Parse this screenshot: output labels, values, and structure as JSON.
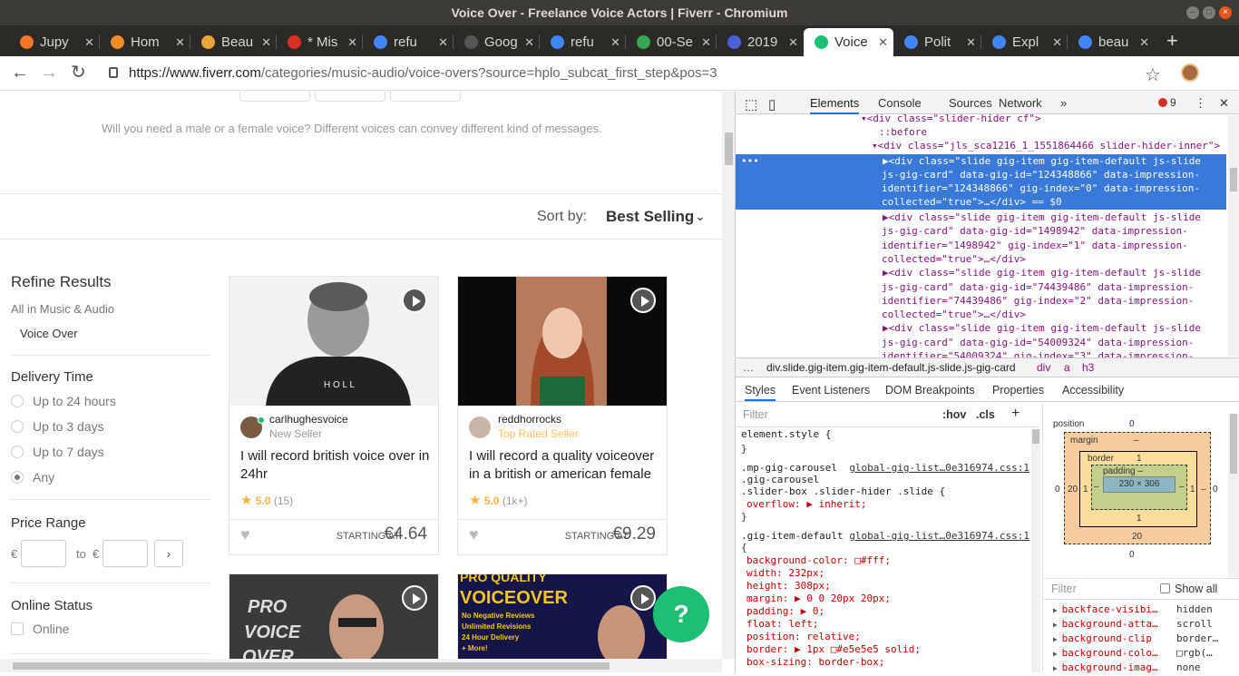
{
  "window": {
    "title": "Voice Over - Freelance Voice Actors | Fiverr - Chromium"
  },
  "tabs": [
    {
      "label": "Jupy",
      "icon": "jupyter-icon",
      "color": "#f37726"
    },
    {
      "label": "Hom",
      "icon": "home-icon",
      "color": "#f28b25"
    },
    {
      "label": "Beau",
      "icon": "book-icon",
      "color": "#e8a33d"
    },
    {
      "label": "* Mis",
      "icon": "notes-icon",
      "color": "#d93025"
    },
    {
      "label": "refu",
      "icon": "google-icon",
      "color": "#4285f4"
    },
    {
      "label": "Goog",
      "icon": "wikipedia-icon",
      "color": "#555555"
    },
    {
      "label": "refu",
      "icon": "google-icon",
      "color": "#4285f4"
    },
    {
      "label": "00-Se",
      "icon": "drive-icon",
      "color": "#34a853"
    },
    {
      "label": "2019",
      "icon": "docs-icon",
      "color": "#4a62d8"
    },
    {
      "label": "Voice",
      "icon": "fiverr-icon",
      "color": "#1dbf73",
      "active": true
    },
    {
      "label": "Polit",
      "icon": "google-icon",
      "color": "#4285f4"
    },
    {
      "label": "Expl",
      "icon": "google-icon",
      "color": "#4285f4"
    },
    {
      "label": "beau",
      "icon": "google-icon",
      "color": "#4285f4"
    }
  ],
  "addressbar": {
    "host": "https://www.fiverr.com",
    "path": "/categories/music-audio/voice-overs?source=hplo_subcat_first_step&pos=3"
  },
  "page": {
    "voice_hint": "Will you need a male or a female voice? Different voices can convey different kind of messages.",
    "sort_label": "Sort by:",
    "sort_value": "Best Selling",
    "sidebar": {
      "refine_title": "Refine Results",
      "all_in": "All in Music & Audio",
      "subcategory": "Voice Over",
      "delivery_title": "Delivery Time",
      "delivery_options": [
        "Up to 24 hours",
        "Up to 3 days",
        "Up to 7 days",
        "Any"
      ],
      "delivery_selected": "Any",
      "price_title": "Price Range",
      "currency": "€",
      "to_label": "to",
      "go_label": "›",
      "online_title": "Online Status",
      "online_label": "Online"
    },
    "gigs": [
      {
        "seller": "carlhughesvoice",
        "level": "New Seller",
        "level_color": "#999999",
        "title": "I will record british voice over in 24hr",
        "rating": "5.0",
        "reviews": "(15)",
        "starting": "STARTING AT",
        "price": "€4.64"
      },
      {
        "seller": "reddhorrocks",
        "level": "Top Rated Seller",
        "level_color": "#ffbe5b",
        "title": "I will record a quality voiceover in a british or american female",
        "rating": "5.0",
        "reviews": "(1k+)",
        "starting": "STARTING AT",
        "price": "€9.29"
      }
    ],
    "banner_gig": {
      "line1": "PRO",
      "line2": "VOICE",
      "line3": "OVER",
      "headline1": "PRO QUALITY",
      "headline2": "VOICEOVER",
      "bullets": [
        "No Negative Reviews",
        "Unlimited Revisions",
        "24 Hour Delivery",
        "+ More!"
      ]
    },
    "help_label": "?"
  },
  "devtools": {
    "tabs": [
      "Elements",
      "Console",
      "Sources",
      "Network"
    ],
    "more": "»",
    "errors": "9",
    "dom_lines": [
      "<div class=\"slider-hider cf\">",
      "::before",
      "<div class=\"jls_sca1216_1_1551864466 slider-hider-inner\">"
    ],
    "selected_lines": [
      "▶<div class=\"slide gig-item gig-item-default js-slide",
      "js-gig-card\" data-gig-id=\"124348866\" data-impression-",
      "identifier=\"124348866\" gig-index=\"0\" data-impression-",
      "collected=\"true\">…</div> == $0"
    ],
    "other_lines": [
      "▶<div class=\"slide gig-item gig-item-default js-slide",
      "js-gig-card\" data-gig-id=\"1498942\" data-impression-",
      "identifier=\"1498942\" gig-index=\"1\" data-impression-",
      "collected=\"true\">…</div>",
      "▶<div class=\"slide gig-item gig-item-default js-slide",
      "js-gig-card\" data-gig-id=\"74439486\" data-impression-",
      "identifier=\"74439486\" gig-index=\"2\" data-impression-",
      "collected=\"true\">…</div>",
      "▶<div class=\"slide gig-item gig-item-default js-slide",
      "js-gig-card\" data-gig-id=\"54009324\" data-impression-",
      "identifier=\"54009324\" gig-index=\"3\" data-impression-"
    ],
    "breadcrumb": [
      "…",
      "div.slide.gig-item.gig-item-default.js-slide.js-gig-card",
      "div",
      "a",
      "h3"
    ],
    "subtabs": [
      "Styles",
      "Event Listeners",
      "DOM Breakpoints",
      "Properties",
      "Accessibility"
    ],
    "filter_placeholder": "Filter",
    "hov": ":hov",
    "cls": ".cls",
    "plus": "+",
    "css_lines": [
      "element.style {",
      "}",
      ".mp-gig-carousel",
      ".gig-carousel",
      ".slider-box .slider-hider .slide {",
      "  overflow: ▶ inherit;",
      "}",
      ".gig-item-default",
      "{",
      "  background-color: □#fff;",
      "  width: 232px;",
      "  height: 308px;",
      "  margin: ▶ 0 0 20px 20px;",
      "  padding: ▶ 0;",
      "  float: left;",
      "  position: relative;",
      "  border: ▶ 1px □#e5e5e5 solid;",
      "  box-sizing: border-box;"
    ],
    "css_source1": "global-gig-list…0e316974.css:1",
    "css_source2": "global-gig-list…0e316974.css:1",
    "boxmodel": {
      "position_label": "position",
      "position_val": "0",
      "margin_label": "margin",
      "margin_val": "–",
      "border_label": "border",
      "border_val": "1",
      "padding_label": "padding –",
      "content": "230 × 306",
      "left_margin": "20",
      "bottom_margin": "20",
      "pos_left": "0",
      "pos_right": "0",
      "pos_bottom": "0",
      "border_side": "1",
      "padding_side": "–",
      "right_margin": "–"
    },
    "computed_filter": "Filter",
    "show_all": "Show all",
    "computed": [
      {
        "prop": "backface-visibi…",
        "val": "hidden"
      },
      {
        "prop": "background-atta…",
        "val": "scroll"
      },
      {
        "prop": "background-clip",
        "val": "border…"
      },
      {
        "prop": "background-colo…",
        "val": "□rgb(…"
      },
      {
        "prop": "background-imag…",
        "val": "none"
      }
    ]
  }
}
